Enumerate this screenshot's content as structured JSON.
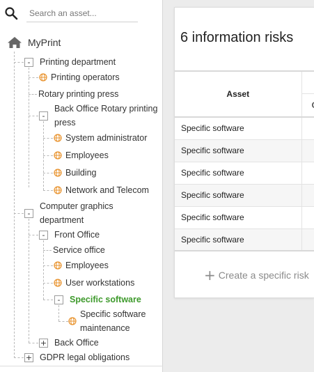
{
  "search": {
    "placeholder": "Search an asset..."
  },
  "tree": {
    "root": "MyPrint",
    "printing_department": "Printing department",
    "printing_operators": "Printing operators",
    "rotary_printing_press": "Rotary printing press",
    "back_office_rotary": "Back Office Rotary printing press",
    "system_administrator": "System administrator",
    "employees_1": "Employees",
    "building": "Building",
    "network_telecom": "Network and Telecom",
    "computer_graphics": "Computer graphics department",
    "front_office": "Front Office",
    "service_office": "Service office",
    "employees_2": "Employees",
    "user_workstations": "User workstations",
    "specific_software": "Specific software",
    "specific_software_maintenance": "Specific software maintenance",
    "back_office": "Back Office",
    "gdpr": "GDPR legal obligations"
  },
  "toggles": {
    "expanded": "-",
    "collapsed": "+"
  },
  "colors": {
    "active_node": "#3e9a2c",
    "asset_icon": "#e8912a",
    "home_icon": "#666666"
  },
  "icons": {
    "search": "search-icon",
    "home": "home-icon",
    "asset": "globe-icon",
    "add": "plus-icon"
  },
  "panel": {
    "title": "6 information risks",
    "table": {
      "asset_header": "Asset",
      "sub_header_partial": "C",
      "rows": [
        "Specific software",
        "Specific software",
        "Specific software",
        "Specific software",
        "Specific software",
        "Specific software"
      ]
    },
    "create_label": "Create a specific risk"
  }
}
